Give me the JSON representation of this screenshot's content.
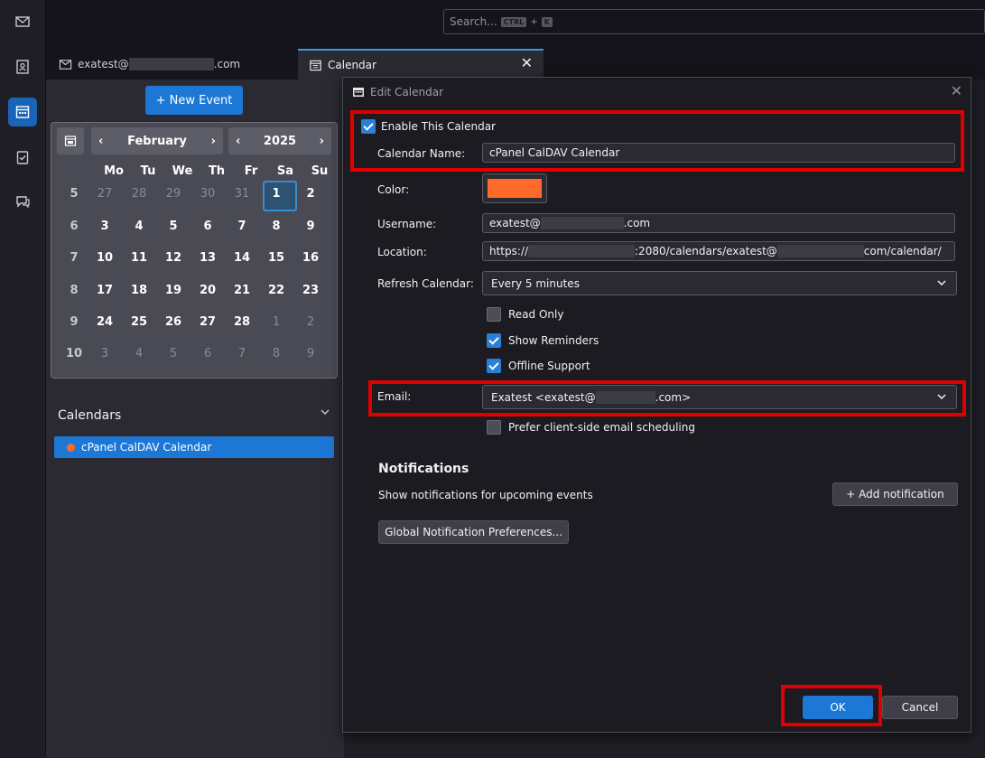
{
  "rail": [
    "mail-icon",
    "address-book-icon",
    "calendar-icon",
    "tasks-icon",
    "chat-icon"
  ],
  "search": {
    "placeholder": "Search...",
    "kbd1": "CTRL",
    "plus": "+",
    "kbd2": "K"
  },
  "tabs": {
    "mail": {
      "prefix": "exatest@",
      "suffix": ".com"
    },
    "calendar": {
      "label": "Calendar",
      "close": "✕"
    }
  },
  "sidebar": {
    "new_event": "+ New Event",
    "month": "February",
    "year": "2025",
    "weekdays": [
      "Mo",
      "Tu",
      "We",
      "Th",
      "Fr",
      "Sa",
      "Su"
    ],
    "weeks": [
      {
        "num": "5",
        "days": [
          "27",
          "28",
          "29",
          "30",
          "31",
          "1",
          "2"
        ]
      },
      {
        "num": "6",
        "days": [
          "3",
          "4",
          "5",
          "6",
          "7",
          "8",
          "9"
        ]
      },
      {
        "num": "7",
        "days": [
          "10",
          "11",
          "12",
          "13",
          "14",
          "15",
          "16"
        ]
      },
      {
        "num": "8",
        "days": [
          "17",
          "18",
          "19",
          "20",
          "21",
          "22",
          "23"
        ]
      },
      {
        "num": "9",
        "days": [
          "24",
          "25",
          "26",
          "27",
          "28",
          "1",
          "2"
        ]
      },
      {
        "num": "10",
        "days": [
          "3",
          "4",
          "5",
          "6",
          "7",
          "8",
          "9"
        ]
      }
    ],
    "calendars_title": "Calendars",
    "calendar_item": "cPanel CalDAV Calendar",
    "calendar_color": "#ff6a2a"
  },
  "dialog": {
    "title": "Edit Calendar",
    "enable": "Enable This Calendar",
    "name_label": "Calendar Name:",
    "name_value": "cPanel CalDAV Calendar",
    "color_label": "Color:",
    "color_value": "#ff6a2a",
    "username_label": "Username:",
    "username_prefix": "exatest@",
    "username_suffix": ".com",
    "location_label": "Location:",
    "location_a": "https://",
    "location_b": ":2080/calendars/exatest@",
    "location_c": "com/calendar/",
    "refresh_label": "Refresh Calendar:",
    "refresh_value": "Every 5 minutes",
    "read_only": "Read Only",
    "show_reminders": "Show Reminders",
    "offline": "Offline Support",
    "email_label": "Email:",
    "email_prefix": "Exatest <exatest@",
    "email_suffix": ".com>",
    "prefer_client": "Prefer client-side email scheduling",
    "notif_title": "Notifications",
    "notif_desc": "Show notifications for upcoming events",
    "add_notification": "+ Add notification",
    "global_prefs": "Global Notification Preferences...",
    "ok": "OK",
    "cancel": "Cancel"
  }
}
